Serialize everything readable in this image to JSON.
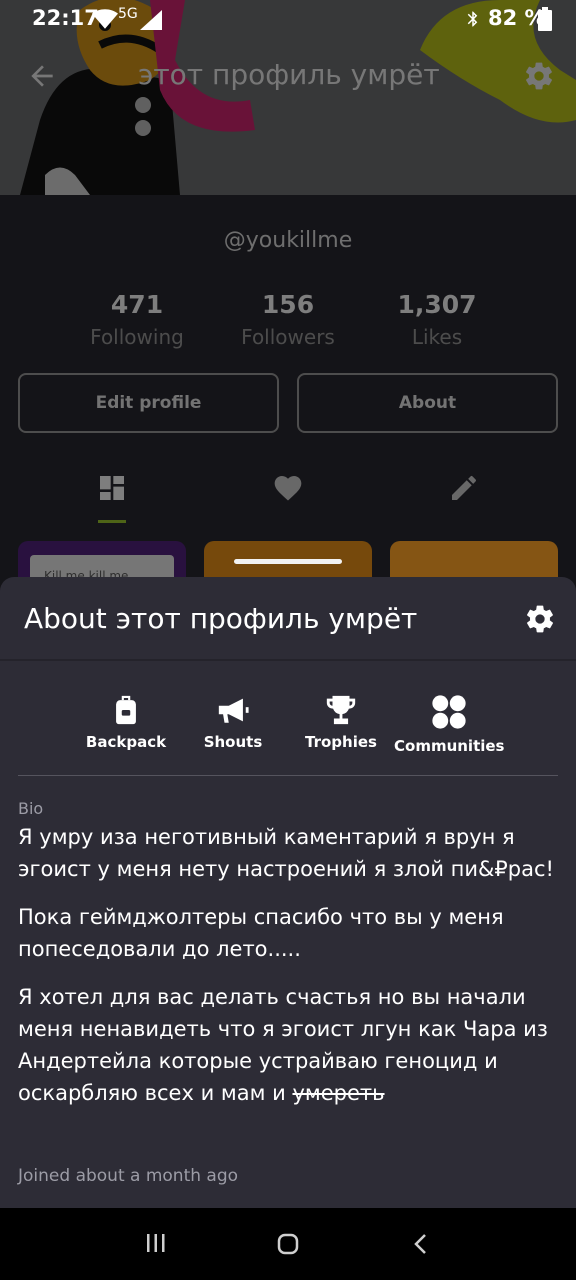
{
  "status_bar": {
    "time": "22:17",
    "network": "5G",
    "battery": "82 %"
  },
  "profile": {
    "title": "этот профиль умрёт",
    "handle": "@youkillme",
    "stats": [
      {
        "value": "471",
        "label": "Following"
      },
      {
        "value": "156",
        "label": "Followers"
      },
      {
        "value": "1,307",
        "label": "Likes"
      }
    ],
    "buttons": {
      "edit": "Edit profile",
      "about": "About"
    },
    "thumb_text": "Kill me kill me"
  },
  "sheet": {
    "title": "About этот профиль умрёт",
    "quick_links": [
      {
        "label": "Backpack",
        "icon": "backpack-icon"
      },
      {
        "label": "Shouts",
        "icon": "megaphone-icon"
      },
      {
        "label": "Trophies",
        "icon": "trophy-icon"
      },
      {
        "label": "Communities",
        "icon": "communities-icon"
      }
    ],
    "bio_label": "Bio",
    "bio_paragraphs": [
      "Я умру иза неготивный каментарий я врун я эгоист у меня нету настроений я злой пи&₽рас!",
      "Пока геймджолтеры спасибо что вы у меня попеседовали до лето.....",
      "Я хотел для вас делать счастья но вы начали меня ненавидеть что я эгоист лгун как Чара из Андертейла которые устрайваю геноцид и оскарбляю всех и мам и"
    ],
    "bio_strike": "умереть",
    "joined": "Joined about a month ago"
  },
  "colors": {
    "accent": "#8fb72a",
    "sheet_bg": "#2d2c36",
    "page_bg": "#26252c"
  }
}
